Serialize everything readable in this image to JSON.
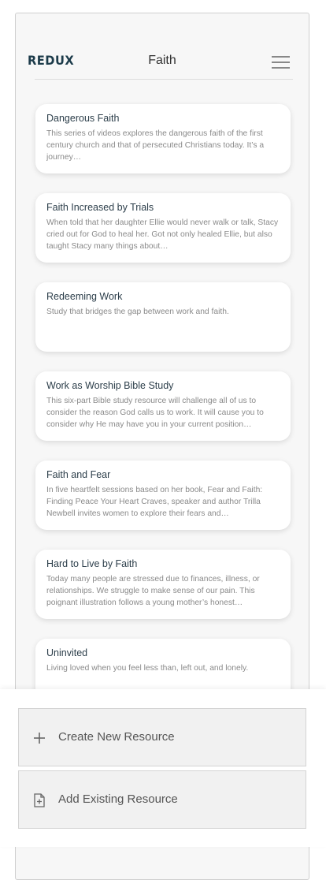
{
  "header": {
    "logo": "REDUX",
    "title": "Faith",
    "menu_icon": "hamburger-menu-icon"
  },
  "resources": [
    {
      "title": "Dangerous Faith",
      "description": "This series of videos explores the dangerous faith of the first century church and that of persecuted Christians today. It’s a journey…"
    },
    {
      "title": "Faith Increased by Trials",
      "description": "When told that her daughter Ellie would never walk or talk, Stacy cried out for God to heal her. Got not only healed Ellie, but also taught Stacy many things about…"
    },
    {
      "title": "Redeeming Work",
      "description": "Study that bridges the gap between work and faith."
    },
    {
      "title": "Work as Worship Bible Study",
      "description": "This six-part Bible study resource will challenge all of us to consider the reason God calls us to work. It will cause you to consider why He may have you in your current position…"
    },
    {
      "title": "Faith and Fear",
      "description": "In five heartfelt sessions based on her book, Fear and Faith: Finding Peace Your Heart Craves, speaker and author Trilla Newbell invites women to explore their fears and…"
    },
    {
      "title": "Hard to Live by Faith",
      "description": "Today many people are stressed due to finances, illness, or relationships. We struggle to make sense of our pain. This poignant illustration follows a young mother’s honest…"
    },
    {
      "title": "Uninvited",
      "description": "Living loved when you feel less than, left out, and lonely."
    }
  ],
  "actions": {
    "create_label": "Create New Resource",
    "create_icon": "plus-icon",
    "add_label": "Add Existing Resource",
    "add_icon": "add-file-icon"
  },
  "colors": {
    "logo": "#1c3b4a",
    "card_title": "#2c3e4a",
    "card_text": "#8a8a8a",
    "action_bg": "#f1f1f1"
  }
}
